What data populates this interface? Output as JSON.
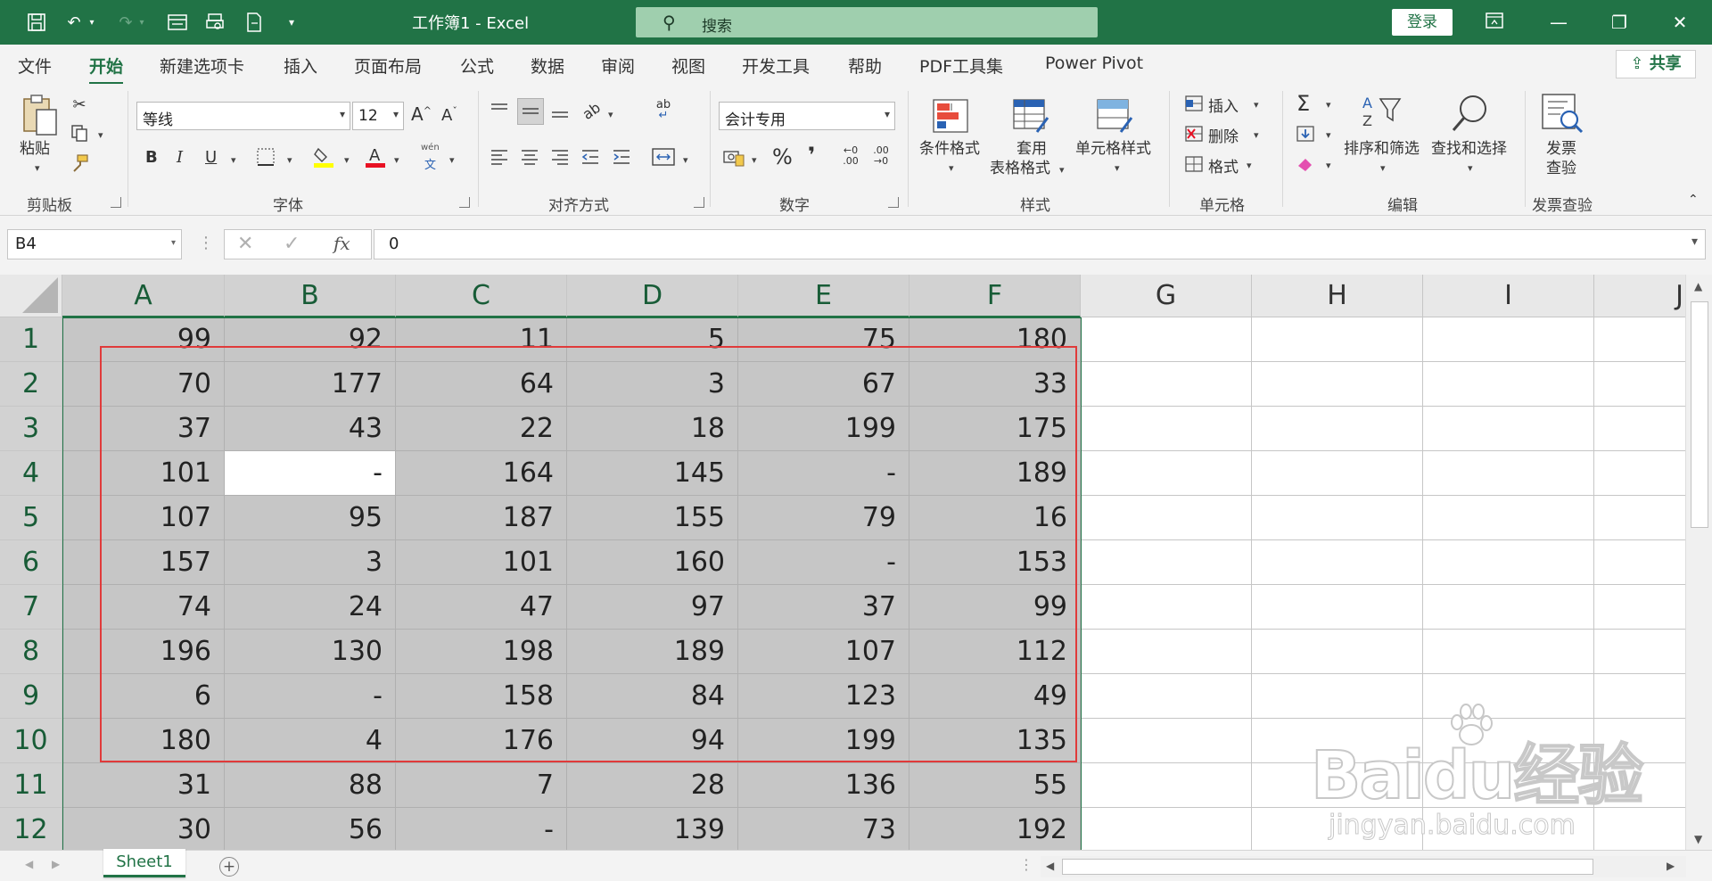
{
  "titlebar": {
    "doc_title": "工作簿1  -  Excel",
    "search_placeholder": "搜索",
    "login_label": "登录"
  },
  "menu": {
    "tabs": [
      "文件",
      "开始",
      "新建选项卡",
      "插入",
      "页面布局",
      "公式",
      "数据",
      "审阅",
      "视图",
      "开发工具",
      "帮助",
      "PDF工具集",
      "Power Pivot"
    ],
    "active_index": 1,
    "share_label": "共享"
  },
  "ribbon": {
    "clipboard": {
      "paste_label": "粘贴",
      "group_label": "剪贴板"
    },
    "font": {
      "font_name": "等线",
      "font_size": "12",
      "group_label": "字体",
      "bold": "B",
      "italic": "I",
      "underline": "U",
      "phonetic_top": "wén",
      "phonetic_bottom": "文"
    },
    "alignment": {
      "group_label": "对齐方式"
    },
    "number": {
      "format": "会计专用",
      "group_label": "数字",
      "percent": "%",
      "comma": "❜"
    },
    "styles": {
      "conditional_label": "条件格式",
      "table_label_1": "套用",
      "table_label_2": "表格格式",
      "cell_styles_label": "单元格样式",
      "group_label": "样式"
    },
    "cells": {
      "insert_label": "插入",
      "delete_label": "删除",
      "format_label": "格式",
      "group_label": "单元格"
    },
    "editing": {
      "sort_label": "排序和筛选",
      "find_label": "查找和选择",
      "group_label": "编辑"
    },
    "invoice": {
      "label_1": "发票",
      "label_2": "查验",
      "group_label": "发票查验"
    }
  },
  "formula_bar": {
    "name_box": "B4",
    "formula": "0"
  },
  "sheet": {
    "columns": [
      "A",
      "B",
      "C",
      "D",
      "E",
      "F",
      "G",
      "H",
      "I",
      "J"
    ],
    "rows": [
      [
        "99",
        "92",
        "11",
        "5",
        "75",
        "180"
      ],
      [
        "70",
        "177",
        "64",
        "3",
        "67",
        "33"
      ],
      [
        "37",
        "43",
        "22",
        "18",
        "199",
        "175"
      ],
      [
        "101",
        "-",
        "164",
        "145",
        "-",
        "189"
      ],
      [
        "107",
        "95",
        "187",
        "155",
        "79",
        "16"
      ],
      [
        "157",
        "3",
        "101",
        "160",
        "-",
        "153"
      ],
      [
        "74",
        "24",
        "47",
        "97",
        "37",
        "99"
      ],
      [
        "196",
        "130",
        "198",
        "189",
        "107",
        "112"
      ],
      [
        "6",
        "-",
        "158",
        "84",
        "123",
        "49"
      ],
      [
        "180",
        "4",
        "176",
        "94",
        "199",
        "135"
      ],
      [
        "31",
        "88",
        "7",
        "28",
        "136",
        "55"
      ],
      [
        "30",
        "56",
        "-",
        "139",
        "73",
        "192"
      ]
    ],
    "active_cell": "B4"
  },
  "bottom": {
    "sheet_tab": "Sheet1"
  },
  "watermark": {
    "logo": "Baidu经验",
    "url": "jingyan.baidu.com"
  }
}
